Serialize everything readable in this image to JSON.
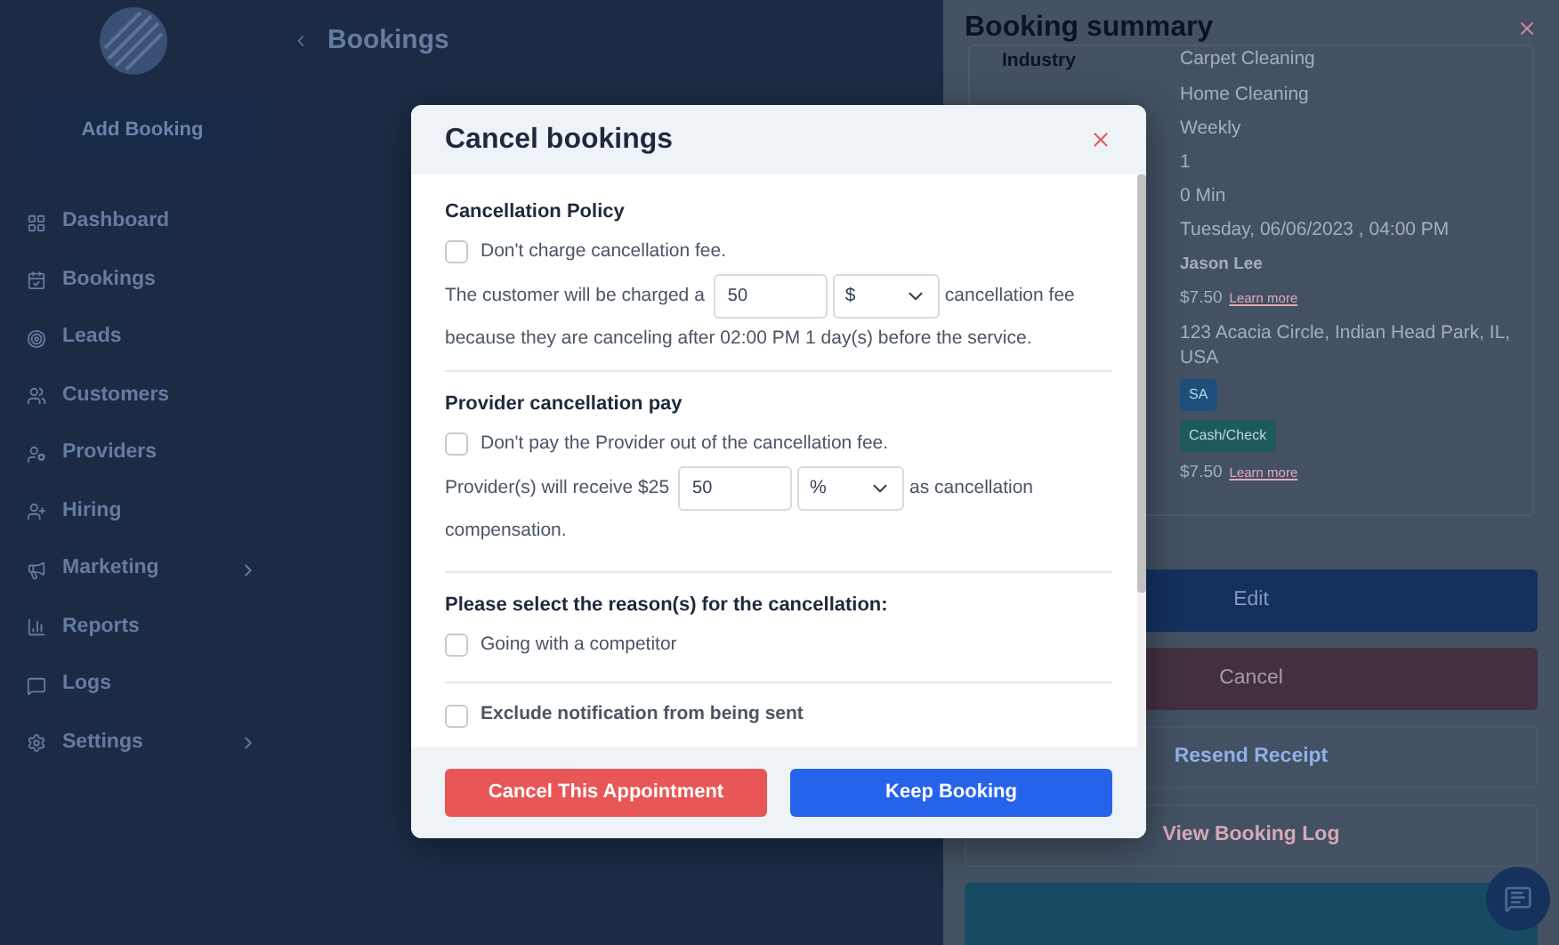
{
  "sidebar": {
    "add_button": "Add Booking",
    "items": [
      {
        "label": "Dashboard",
        "kind": "link"
      },
      {
        "label": "Bookings",
        "kind": "link"
      },
      {
        "label": "Leads",
        "kind": "link"
      },
      {
        "label": "Customers",
        "kind": "link"
      },
      {
        "label": "Providers",
        "kind": "link"
      },
      {
        "label": "Hiring",
        "kind": "link"
      },
      {
        "label": "Marketing",
        "kind": "submenu"
      },
      {
        "label": "Reports",
        "kind": "link"
      },
      {
        "label": "Logs",
        "kind": "link"
      },
      {
        "label": "Settings",
        "kind": "submenu"
      }
    ]
  },
  "main": {
    "title": "Bookings"
  },
  "summary_panel": {
    "title": "Booking summary",
    "rows": [
      {
        "kind": "text",
        "label": "Industry",
        "value": "Carpet Cleaning"
      },
      {
        "kind": "text",
        "value": "Home Cleaning"
      },
      {
        "kind": "text",
        "value": "Weekly"
      },
      {
        "kind": "text",
        "value": "1"
      },
      {
        "kind": "text",
        "value": "0 Min"
      },
      {
        "kind": "text",
        "value": "Tuesday, 06/06/2023 , 04:00 PM"
      },
      {
        "kind": "bold",
        "value": "Jason Lee"
      },
      {
        "kind": "price",
        "value": "$7.50",
        "link": "Learn more"
      },
      {
        "kind": "text",
        "value": "123 Acacia Circle, Indian Head Park, IL, USA"
      },
      {
        "kind": "badge",
        "value": "SA",
        "color": "#1d4f7a"
      },
      {
        "kind": "badge",
        "value": "Cash/Check",
        "color": "#1f5a5a"
      },
      {
        "kind": "price",
        "value": "$7.50",
        "link": "Learn more"
      }
    ],
    "actions": [
      {
        "kind": "primary",
        "label": "Edit"
      },
      {
        "kind": "danger",
        "label": "Cancel"
      },
      {
        "kind": "link",
        "label": "Resend Receipt"
      },
      {
        "kind": "muted",
        "label": "View Booking Log"
      },
      {
        "kind": "teal"
      }
    ]
  },
  "modal": {
    "title": "Cancel bookings",
    "policy": {
      "heading": "Cancellation Policy",
      "checkbox": {
        "label": "Don't charge cancellation fee.",
        "checked": false
      },
      "prefix": "The customer will be charged a",
      "amount": "50",
      "unit": "$",
      "suffix": "cancellation fee",
      "note": "because they are canceling after 02:00 PM 1 day(s) before the service."
    },
    "provider": {
      "heading": "Provider cancellation pay",
      "checkbox": {
        "label": "Don't pay the Provider out of the cancellation fee.",
        "checked": false
      },
      "prefix": "Provider(s) will receive $25",
      "amount": "50",
      "unit": "%",
      "suffix": "as cancellation",
      "note": "compensation."
    },
    "reasons": {
      "heading": "Please select the reason(s) for the cancellation:",
      "options": [
        {
          "label": "Going with a competitor",
          "checked": false
        }
      ]
    },
    "exclude": {
      "label": "Exclude notification from being sent",
      "checked": false
    },
    "buttons": [
      {
        "kind": "danger",
        "label": "Cancel This Appointment"
      },
      {
        "kind": "primary",
        "label": "Keep Booking"
      }
    ]
  }
}
